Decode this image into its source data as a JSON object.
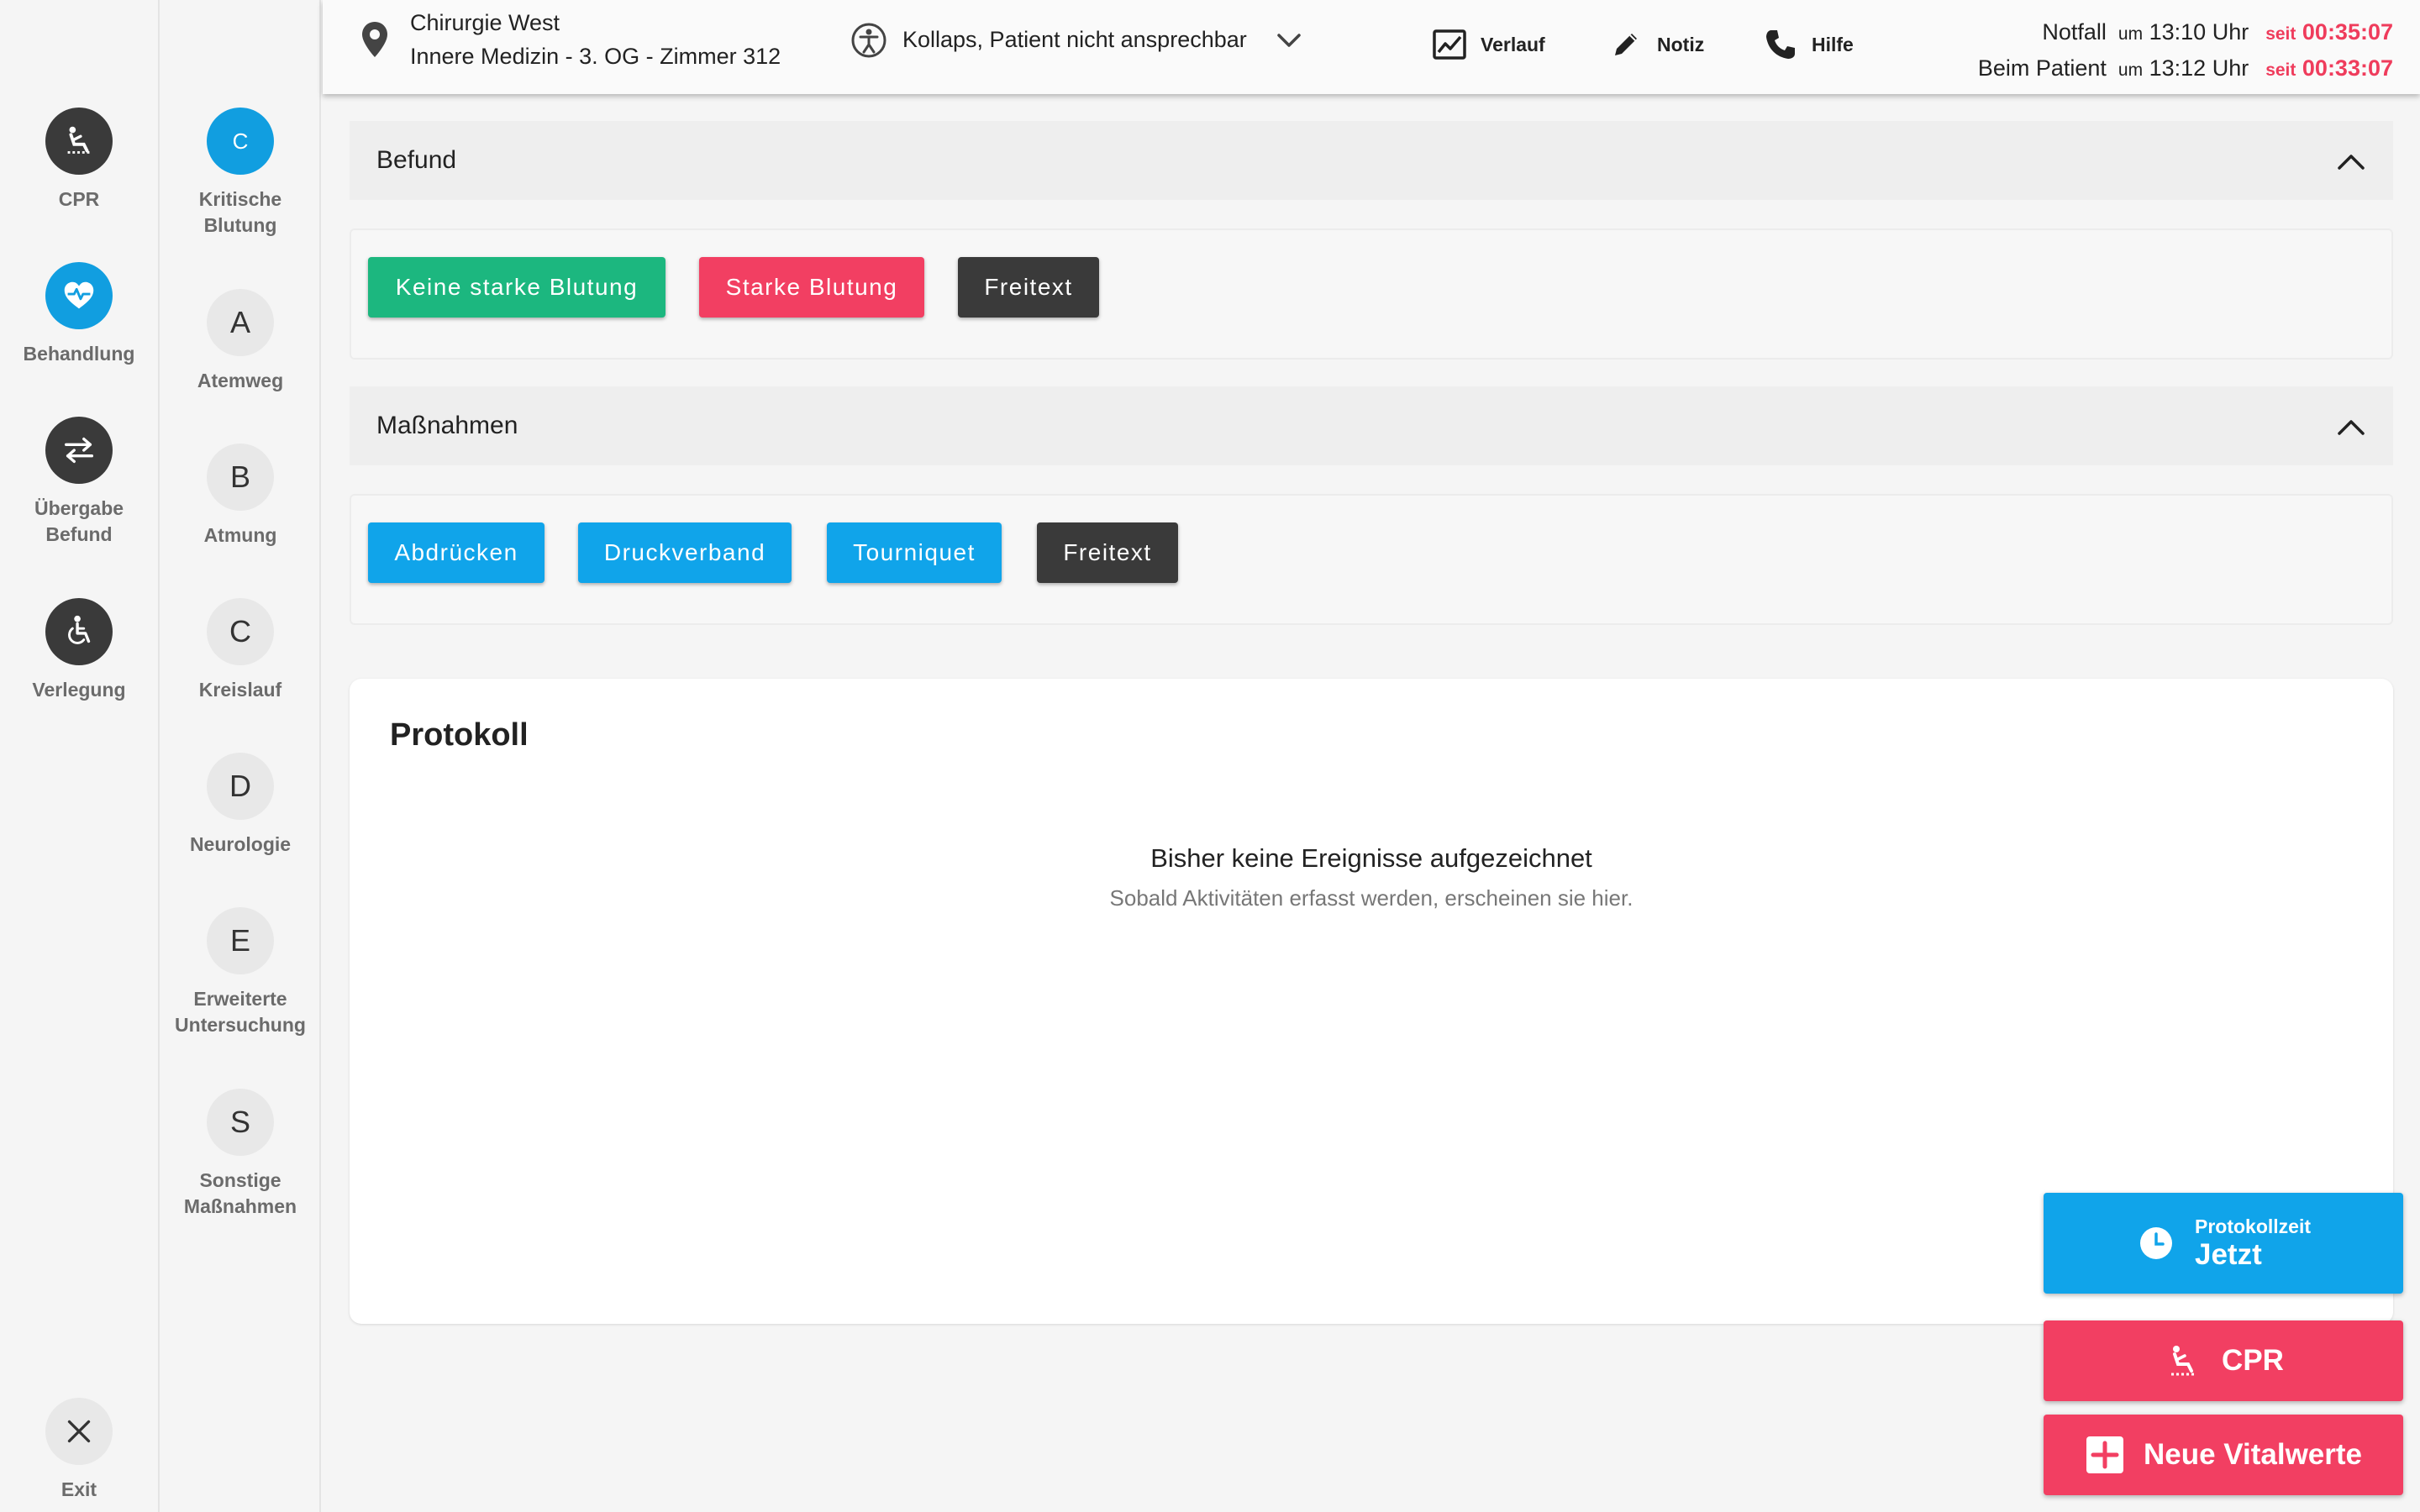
{
  "rail_primary": {
    "items": [
      {
        "label": "CPR",
        "icon": "cpr-icon"
      },
      {
        "label": "Behandlung",
        "icon": "heart-pulse-icon"
      },
      {
        "label_line1": "Übergabe",
        "label_line2": "Befund",
        "icon": "swap-arrows-icon"
      },
      {
        "label": "Verlegung",
        "icon": "wheelchair-icon"
      }
    ],
    "exit_label": "Exit"
  },
  "rail_secondary": {
    "items": [
      {
        "letter": "C",
        "label_line1": "Kritische",
        "label_line2": "Blutung"
      },
      {
        "letter": "A",
        "label": "Atemweg"
      },
      {
        "letter": "B",
        "label": "Atmung"
      },
      {
        "letter": "C",
        "label": "Kreislauf"
      },
      {
        "letter": "D",
        "label": "Neurologie"
      },
      {
        "letter": "E",
        "label_line1": "Erweiterte",
        "label_line2": "Untersuchung"
      },
      {
        "letter": "S",
        "label_line1": "Sonstige",
        "label_line2": "Maßnahmen"
      }
    ]
  },
  "header": {
    "location_line1": "Chirurgie West",
    "location_line2": "Innere Medizin - 3. OG - Zimmer 312",
    "diagnosis": "Kollaps, Patient nicht ansprechbar",
    "verlauf_label": "Verlauf",
    "notiz_label": "Notiz",
    "hilfe_label": "Hilfe",
    "notfall_label": "Notfall",
    "notfall_um": "um",
    "notfall_time": "13:10 Uhr",
    "notfall_seit": "seit",
    "notfall_duration": "00:35:07",
    "patient_label": "Beim Patient",
    "patient_um": "um",
    "patient_time": "13:12 Uhr",
    "patient_seit": "seit",
    "patient_duration": "00:33:07"
  },
  "befund": {
    "title": "Befund",
    "buttons": [
      "Keine starke Blutung",
      "Starke Blutung",
      "Freitext"
    ]
  },
  "massnahmen": {
    "title": "Maßnahmen",
    "buttons": [
      "Abdrücken",
      "Druckverband",
      "Tourniquet",
      "Freitext"
    ]
  },
  "protokoll": {
    "title": "Protokoll",
    "empty_title": "Bisher keine Ereignisse aufgezeichnet",
    "empty_subtitle": "Sobald Aktivitäten erfasst werden, erscheinen sie hier."
  },
  "actions": {
    "protokollzeit_label": "Protokollzeit",
    "protokollzeit_value": "Jetzt",
    "cpr_label": "CPR",
    "vital_label": "Neue Vitalwerte"
  },
  "colors": {
    "accent_blue": "#10a4ea",
    "alert_red": "#f23f62",
    "success_green": "#1cb77f",
    "dark": "#3a3a3a"
  }
}
